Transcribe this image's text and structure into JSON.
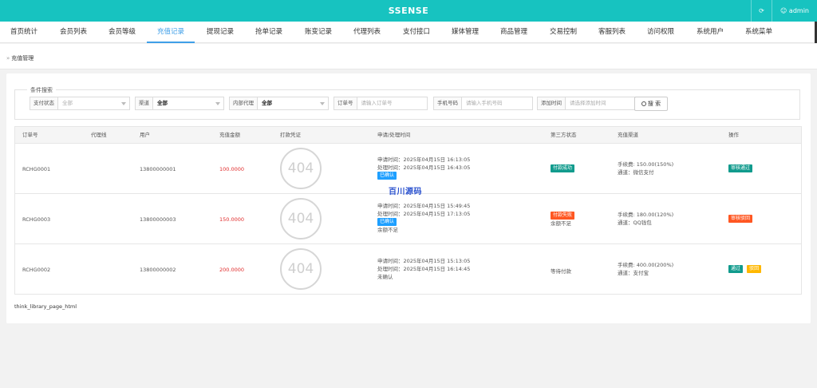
{
  "header": {
    "title": "SSENSE",
    "user": "admin",
    "refresh_icon": "refresh-icon",
    "user_icon": "user-icon"
  },
  "nav": {
    "items": [
      "首页统计",
      "会员列表",
      "会员等级",
      "充值记录",
      "提现记录",
      "抢单记录",
      "账变记录",
      "代理列表",
      "支付接口",
      "媒体管理",
      "商品管理",
      "交易控制",
      "客服列表",
      "访问权限",
      "系统用户",
      "系统菜单"
    ],
    "active": "充值记录"
  },
  "breadcrumb": {
    "text": "充值管理"
  },
  "search": {
    "legend": "条件搜索",
    "pay_status": {
      "label": "支付状态",
      "value": "全部"
    },
    "channel": {
      "label": "渠道",
      "value": "全部"
    },
    "agent": {
      "label": "内部代理",
      "value": "全部"
    },
    "order_no": {
      "label": "订单号",
      "placeholder": "请输入订单号"
    },
    "phone": {
      "label": "手机号码",
      "placeholder": "请输入手机号码"
    },
    "add_time": {
      "label": "添加时间",
      "placeholder": "请选择添加时间"
    },
    "button": "搜 索"
  },
  "table": {
    "columns": [
      "订单号",
      "代理线",
      "用户",
      "充值金额",
      "打款凭证",
      "申请/处理时间",
      "第三方状态",
      "充值渠道",
      "操作"
    ],
    "rows": [
      {
        "order": "RCHG0001",
        "user": "13800000001",
        "amount": "100.0000",
        "proof": "404",
        "apply": "申请时间：2025年04月15日 16:13:05",
        "process": "处理时间：2025年04月15日 16:43:05",
        "confirm": "已确认",
        "note": "",
        "status_badge": "付款成功",
        "status_text": "",
        "fee": "手续费: 150.00(150%)",
        "channel": "通道：微信支付",
        "actions": [
          "审核通过"
        ]
      },
      {
        "order": "RCHG0003",
        "user": "13800000003",
        "amount": "150.0000",
        "proof": "404",
        "apply": "申请时间：2025年04月15日 15:49:45",
        "process": "处理时间：2025年04月15日 17:13:05",
        "confirm": "已确认",
        "note": "余额不足",
        "status_badge": "付款失败",
        "status_text": "余额不足",
        "fee": "手续费: 180.00(120%)",
        "channel": "通道：QQ钱包",
        "actions": [
          "审核驳回"
        ]
      },
      {
        "order": "RCHG0002",
        "user": "13800000002",
        "amount": "200.0000",
        "proof": "404",
        "apply": "申请时间：2025年04月15日 15:13:05",
        "process": "处理时间：2025年04月15日 16:14:45",
        "confirm": "",
        "note": "未确认",
        "status_badge": "",
        "status_text": "等待付款",
        "fee": "手续费: 400.00(200%)",
        "channel": "通道：支付宝",
        "actions": [
          "通过",
          "驳回"
        ]
      }
    ]
  },
  "watermark": "百川源码",
  "footer": "think_library_page_html",
  "colors": {
    "accent": "#17c3c0",
    "link": "#3f9fe8",
    "green": "#119b8d",
    "orange": "#ff5722",
    "blue": "#1e9fff",
    "yellow": "#ffb800",
    "red": "#e02a2a"
  }
}
